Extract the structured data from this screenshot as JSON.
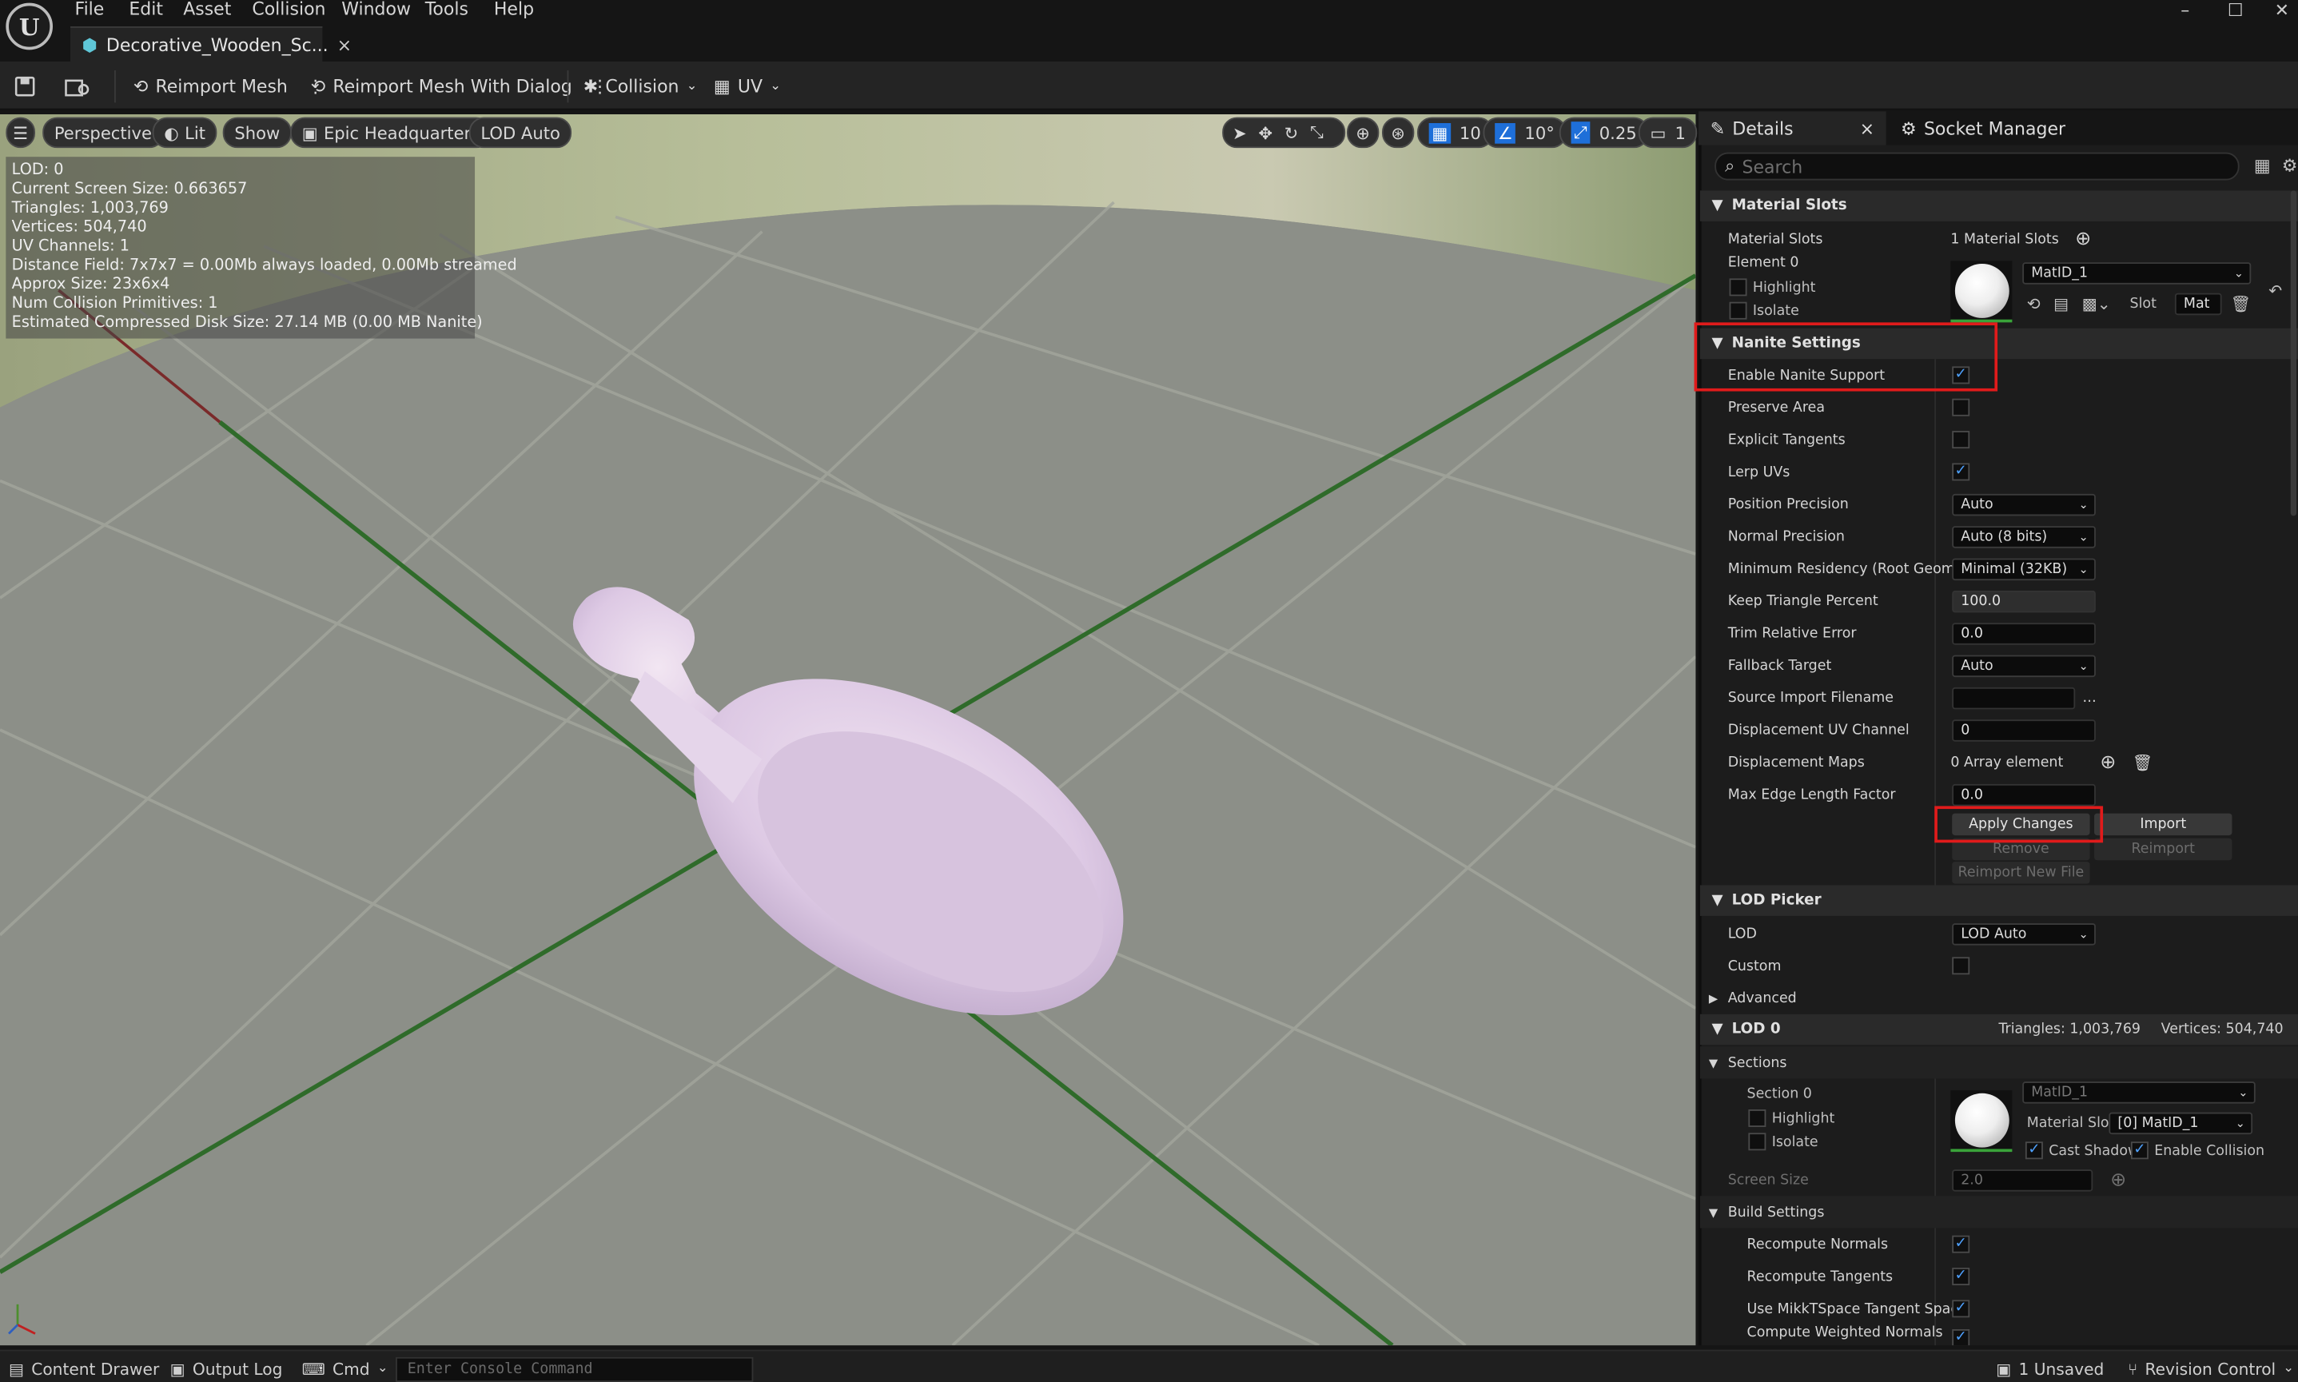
{
  "menu": [
    "File",
    "Edit",
    "Asset",
    "Collision",
    "Window",
    "Tools",
    "Help"
  ],
  "tab": {
    "title": "Decorative_Wooden_Sc...",
    "close": "×"
  },
  "window_controls": [
    "–",
    "☐",
    "✕"
  ],
  "toolbar": {
    "reimport_mesh": "Reimport Mesh",
    "reimport_dialog": "Reimport Mesh With Dialog",
    "collision": "Collision",
    "uv": "UV"
  },
  "viewport": {
    "perspective": "Perspective",
    "lit": "Lit",
    "show": "Show",
    "environment": "Epic Headquarters",
    "lod": "LOD Auto",
    "grid_snap": "10",
    "rotate_snap": "10°",
    "scale_snap": "0.25",
    "camera_speed": "1"
  },
  "stats": [
    "LOD:  0",
    "Current Screen Size:  0.663657",
    "Triangles:  1,003,769",
    "Vertices:  504,740",
    "UV Channels:  1",
    "Distance Field:  7x7x7 = 0.00Mb always loaded, 0.00Mb streamed",
    "Approx Size: 23x6x4",
    "Num Collision Primitives:  1",
    "Estimated Compressed Disk Size: 27.14 MB (0.00 MB Nanite)"
  ],
  "panel": {
    "details_tab": "Details",
    "close": "×",
    "socket_tab": "Socket Manager",
    "search_placeholder": "Search",
    "material_slots": {
      "header": "Material Slots",
      "label": "Material Slots",
      "value": "1 Material Slots",
      "element": "Element 0",
      "highlight": "Highlight",
      "isolate": "Isolate",
      "material": "MatID_1",
      "slot_label": "Slot",
      "slot_value": "Mat"
    },
    "nanite": {
      "header": "Nanite Settings",
      "enable": "Enable Nanite Support",
      "preserve_area": "Preserve Area",
      "explicit_tangents": "Explicit Tangents",
      "lerp_uvs": "Lerp UVs",
      "position_precision": "Position Precision",
      "position_precision_value": "Auto",
      "normal_precision": "Normal Precision",
      "normal_precision_value": "Auto (8 bits)",
      "min_residency": "Minimum Residency (Root Geometry",
      "min_residency_value": "Minimal (32KB)",
      "keep_triangle": "Keep Triangle Percent",
      "keep_triangle_value": "100.0",
      "trim_error": "Trim Relative Error",
      "trim_error_value": "0.0",
      "fallback": "Fallback Target",
      "fallback_value": "Auto",
      "source_import": "Source Import Filename",
      "source_import_value": "",
      "displacement_uv": "Displacement UV Channel",
      "displacement_uv_value": "0",
      "displacement_maps": "Displacement Maps",
      "displacement_maps_value": "0 Array element",
      "max_edge": "Max Edge Length Factor",
      "max_edge_value": "0.0",
      "apply": "Apply Changes",
      "import": "Import",
      "remove": "Remove",
      "reimport": "Reimport",
      "reimport_new": "Reimport New File"
    },
    "lod_picker": {
      "header": "LOD Picker",
      "lod": "LOD",
      "lod_value": "LOD Auto",
      "custom": "Custom"
    },
    "advanced": "Advanced",
    "lod0": {
      "header": "LOD 0",
      "triangles": "Triangles: 1,003,769",
      "vertices": "Vertices: 504,740",
      "sections": "Sections",
      "section0": "Section 0",
      "highlight": "Highlight",
      "isolate": "Isolate",
      "material": "MatID_1",
      "material_slot_label": "Material Slot",
      "material_slot_value": "[0] MatID_1",
      "cast_shadow": "Cast Shadow",
      "enable_collision": "Enable Collision",
      "screen_size": "Screen Size",
      "screen_size_value": "2.0"
    },
    "build": {
      "header": "Build Settings",
      "recompute_normals": "Recompute Normals",
      "recompute_tangents": "Recompute Tangents",
      "mikkt": "Use MikkTSpace Tangent Space",
      "weighted": "Compute Weighted Normals"
    }
  },
  "status": {
    "content_drawer": "Content Drawer",
    "output_log": "Output Log",
    "cmd": "Cmd",
    "console_placeholder": "Enter Console Command",
    "unsaved": "1 Unsaved",
    "revision": "Revision Control"
  },
  "colors": {
    "accent": "#4ea1ff",
    "highlight_box": "#e01b1b",
    "mesh": "#e0cfe8",
    "floor": "#8a8d88"
  }
}
